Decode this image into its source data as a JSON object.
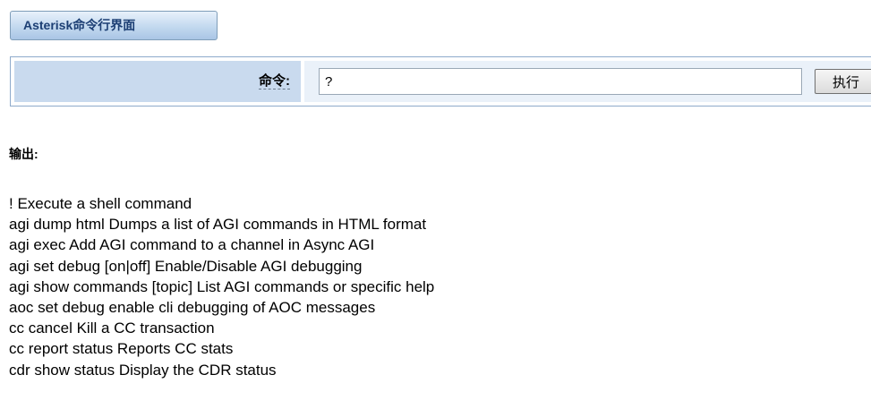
{
  "header": {
    "title": "Asterisk命令行界面"
  },
  "command_form": {
    "label": "命令:",
    "input_value": "?",
    "execute_label": "执行"
  },
  "output": {
    "label": "输出:",
    "lines": [
      "! Execute a shell command",
      "agi dump html Dumps a list of AGI commands in HTML format",
      "agi exec Add AGI command to a channel in Async AGI",
      "agi set debug [on|off] Enable/Disable AGI debugging",
      "agi show commands [topic] List AGI commands or specific help",
      "aoc set debug enable cli debugging of AOC messages",
      "cc cancel Kill a CC transaction",
      "cc report status Reports CC stats",
      "cdr show status Display the CDR status"
    ]
  }
}
